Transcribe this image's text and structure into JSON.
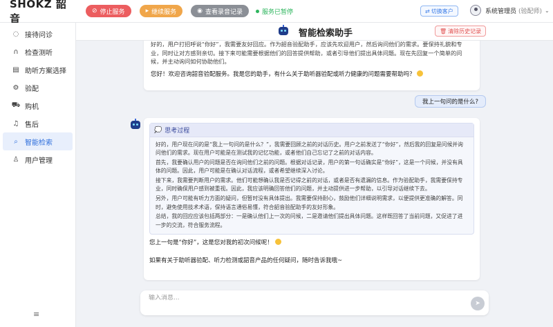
{
  "app": {
    "logo": "SHOKZ 韶音"
  },
  "topbar": {
    "stop_label": "停止服务",
    "continue_label": "继续服务",
    "log_label": "查看录音记录",
    "status_text": "服务已暂停",
    "switch_label": "切换客户",
    "user_name": "系统管理员",
    "user_role": "(验配师)"
  },
  "sidebar": {
    "items": [
      {
        "label": "接待问诊",
        "icon": "chat-icon"
      },
      {
        "label": "检查测听",
        "icon": "headphones-icon"
      },
      {
        "label": "助听方案选择",
        "icon": "clipboard-icon"
      },
      {
        "label": "验配",
        "icon": "settings-icon"
      },
      {
        "label": "购机",
        "icon": "cart-icon"
      },
      {
        "label": "售后",
        "icon": "headset-icon"
      },
      {
        "label": "智能检索",
        "icon": "search-icon"
      },
      {
        "label": "用户管理",
        "icon": "user-icon"
      }
    ],
    "active_index": 6
  },
  "main": {
    "title": "智能检索助手",
    "clear_label": "清除历史记录"
  },
  "messages": {
    "first_quote": "好的，用户打招呼说“你好”，我需要友好回应。作为韶音验配助手，应该先欢迎用户，然后询问他们的需求。要保持礼貌和专业，同时让对方感到亲切。接下来可能需要根据他们的回答提供帮助，或者引导他们提出具体问题。现在先回复一个简单的问候，并主动询问如何协助他们。",
    "first_reply": "您好！欢迎咨询韶音验配服务。我是您的助手，有什么关于助听器验配或听力健康的问题需要帮助吗？",
    "user_question": "我上一句问的是什么?",
    "think_title": "思考过程",
    "think_paragraphs": [
      "好的，用户现在问的是“我上一句问的是什么？”，我需要回顾之前的对话历史。用户之前发送了“你好”，然后我的回复是问候并询问他们的需求。现在用户可能是在测试我的记忆功能，或者他们自己忘记了之前的对话内容。",
      "首先，我要确认用户的问题是否在询问他们之前的问题。根据对话记录，用户的第一句话确实是“你好”，这是一个问候，并没有具体的问题。因此，用户可能是在确认对话流程，或者希望继续深入讨论。",
      "接下来，我需要判断用户的需求。他们可能想确认我是否记得之前的对话，或者是否有遗漏的信息。作为验配助手，我需要保持专业，同时确保用户感到被重视。因此，我应该明确回答他们的问题，并主动提供进一步帮助，以引导对话继续下去。",
      "另外，用户可能有听力方面的疑问，但暂时没有具体提出。我需要保持耐心，鼓励他们详细说明需求，以便提供更准确的解答。同时，避免使用技术术语，保持语言通俗易懂，符合韶音验配助手的友好形象。",
      "总结，我的回应应该包括两部分：一是确认他们上一次的问候，二是邀请他们提出具体问题。这样既回答了当前问题，又促进了进一步的交流，符合服务流程。"
    ],
    "answer_1": "您上一句是“你好”，这是您对我的初次问候呢！",
    "answer_2": "如果有关于助听器验配、听力检测或韶音产品的任何疑问，随时告诉我哦~"
  },
  "input": {
    "placeholder": "输入消息..."
  },
  "colors": {
    "stop": "#ec5d5f",
    "continue": "#f0a64a",
    "log": "#8b8f96",
    "status": "#2db55d",
    "accent": "#2f6fdc"
  }
}
